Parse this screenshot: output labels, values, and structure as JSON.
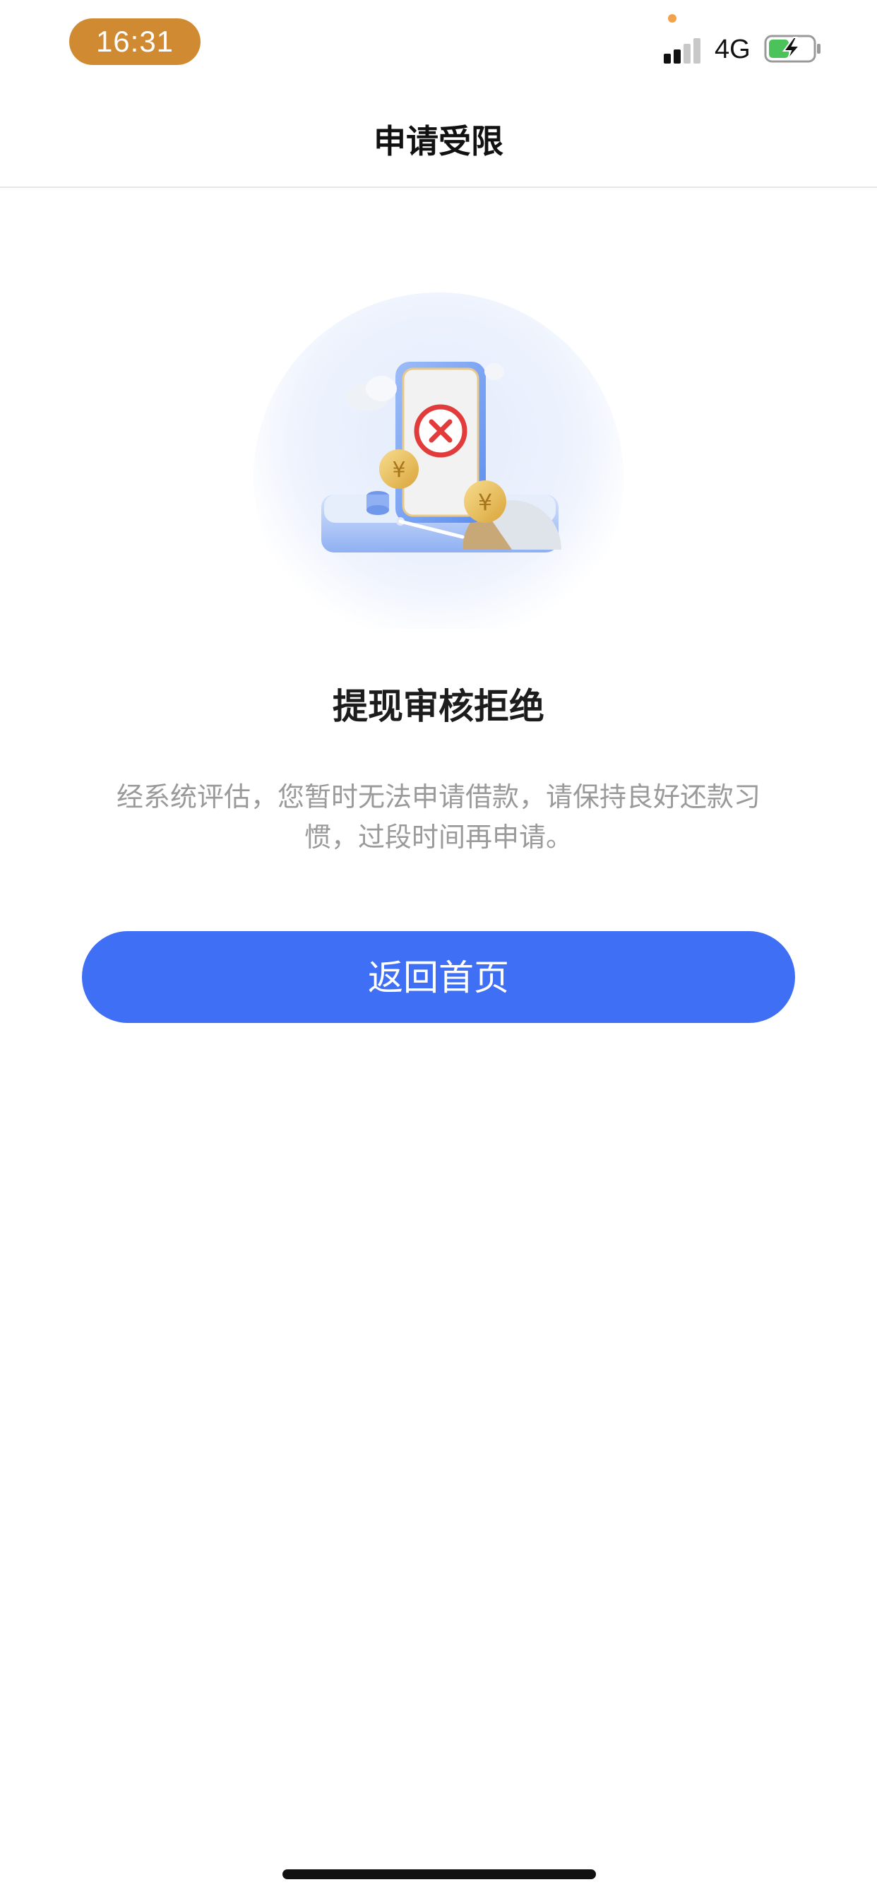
{
  "status_bar": {
    "time": "16:31",
    "network": "4G",
    "battery_charging": true,
    "accent_color": "#d08a32"
  },
  "nav": {
    "title": "申请受限"
  },
  "result": {
    "title": "提现审核拒绝",
    "description": "经系统评估，您暂时无法申请借款，请保持良好还款习惯，过段时间再申请。",
    "icon": "rejected-phone-illustration"
  },
  "actions": {
    "home_button_label": "返回首页",
    "button_color": "#3e6ff4"
  }
}
